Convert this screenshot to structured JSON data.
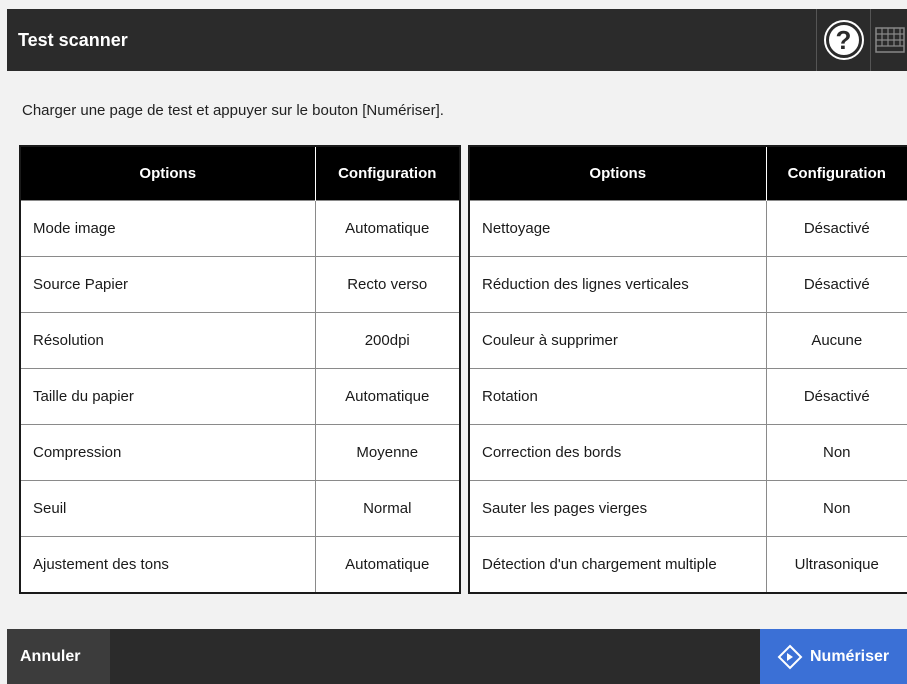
{
  "header": {
    "title": "Test scanner",
    "help_icon": "question-circle-icon",
    "keyboard_icon": "keyboard-icon"
  },
  "instruction": "Charger une page de test et appuyer sur le bouton [Numériser].",
  "tables": {
    "left": {
      "columns": [
        "Options",
        "Configuration"
      ],
      "rows": [
        {
          "option": "Mode image",
          "value": "Automatique"
        },
        {
          "option": "Source Papier",
          "value": "Recto verso"
        },
        {
          "option": "Résolution",
          "value": "200dpi"
        },
        {
          "option": "Taille du papier",
          "value": "Automatique"
        },
        {
          "option": "Compression",
          "value": "Moyenne"
        },
        {
          "option": "Seuil",
          "value": "Normal"
        },
        {
          "option": "Ajustement des tons",
          "value": "Automatique"
        }
      ]
    },
    "right": {
      "columns": [
        "Options",
        "Configuration"
      ],
      "rows": [
        {
          "option": "Nettoyage",
          "value": "Désactivé"
        },
        {
          "option": "Réduction des lignes verticales",
          "value": "Désactivé"
        },
        {
          "option": "Couleur à supprimer",
          "value": "Aucune"
        },
        {
          "option": "Rotation",
          "value": "Désactivé"
        },
        {
          "option": "Correction des bords",
          "value": "Non"
        },
        {
          "option": "Sauter les pages vierges",
          "value": "Non"
        },
        {
          "option": "Détection d'un chargement multiple",
          "value": "Ultrasonique"
        }
      ]
    }
  },
  "footer": {
    "cancel_label": "Annuler",
    "scan_label": "Numériser",
    "scan_icon": "scan-diamond-icon"
  },
  "colors": {
    "header_bg": "#2b2b2b",
    "table_header_bg": "#000000",
    "scan_button_bg": "#3b70d6"
  }
}
